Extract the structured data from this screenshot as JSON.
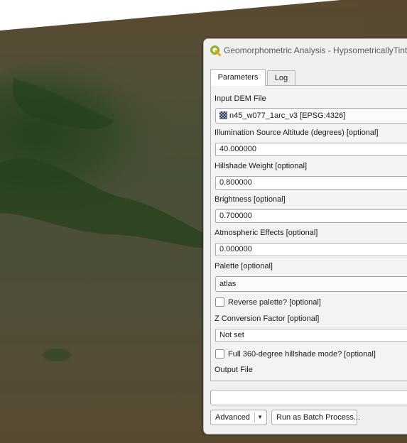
{
  "window": {
    "title": "Geomorphometric Analysis - HypsometricallyTint",
    "icon": "qgis-logo-icon"
  },
  "tabs": [
    {
      "label": "Parameters",
      "active": true
    },
    {
      "label": "Log",
      "active": false
    }
  ],
  "parameters": {
    "input_dem": {
      "label": "Input DEM File",
      "value": "n45_w077_1arc_v3 [EPSG:4326]",
      "icon": "raster-layer-icon"
    },
    "altitude": {
      "label": "Illumination Source Altitude (degrees) [optional]",
      "value": "40.000000"
    },
    "hillshade_weight": {
      "label": "Hillshade Weight [optional]",
      "value": "0.800000"
    },
    "brightness": {
      "label": "Brightness [optional]",
      "value": "0.700000"
    },
    "atmospheric": {
      "label": "Atmospheric Effects [optional]",
      "value": "0.000000"
    },
    "palette": {
      "label": "Palette [optional]",
      "value": "atlas"
    },
    "reverse_palette": {
      "label": "Reverse palette? [optional]",
      "checked": false
    },
    "z_factor": {
      "label": "Z Conversion Factor [optional]",
      "value": "Not set"
    },
    "full_mode": {
      "label": "Full 360-degree hillshade mode? [optional]",
      "checked": false
    },
    "output_file": {
      "label": "Output File"
    }
  },
  "progress_value": "",
  "buttons": {
    "advanced": "Advanced",
    "batch": "Run as Batch Process..."
  },
  "colors": {
    "dialog_bg": "#f0f0f0",
    "terrain_green": "#5a9a4a",
    "terrain_tan": "#c8aa72"
  }
}
